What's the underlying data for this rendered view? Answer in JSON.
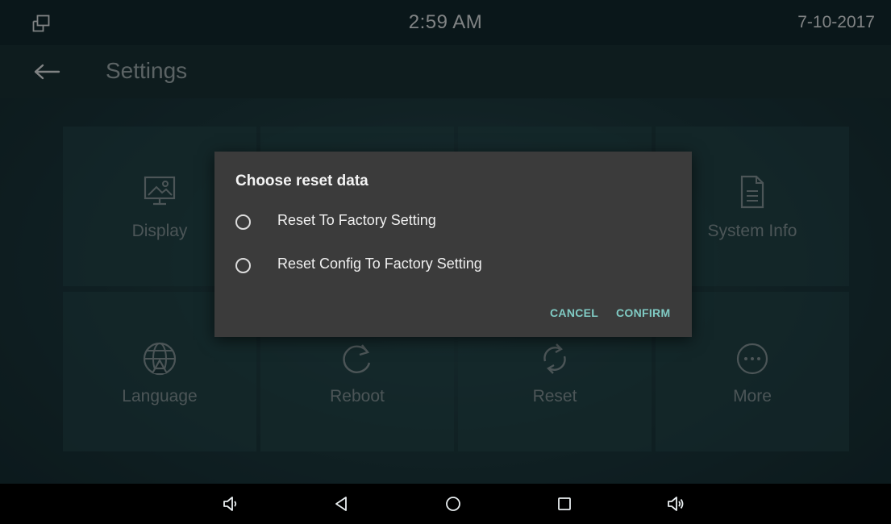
{
  "status_bar": {
    "time": "2:59 AM",
    "date": "7-10-2017",
    "multiwindow_icon": "multi-window-icon"
  },
  "title_bar": {
    "back_icon": "arrow-left-icon",
    "title": "Settings"
  },
  "tiles": [
    {
      "label": "Display",
      "icon": "display-icon"
    },
    {
      "label": "",
      "icon": ""
    },
    {
      "label": "",
      "icon": ""
    },
    {
      "label": "System Info",
      "icon": "document-icon"
    },
    {
      "label": "Language",
      "icon": "globe-icon"
    },
    {
      "label": "Reboot",
      "icon": "reboot-icon"
    },
    {
      "label": "Reset",
      "icon": "sync-icon"
    },
    {
      "label": "More",
      "icon": "more-icon"
    }
  ],
  "dialog": {
    "title": "Choose reset data",
    "options": [
      {
        "label": "Reset To Factory Setting",
        "selected": false
      },
      {
        "label": "Reset Config To Factory Setting",
        "selected": false
      }
    ],
    "cancel_label": "CANCEL",
    "confirm_label": "CONFIRM"
  },
  "nav_bar": {
    "buttons": [
      "volume-down-icon",
      "back-icon",
      "home-icon",
      "recents-icon",
      "volume-up-icon"
    ]
  },
  "colors": {
    "accent": "#80cbc4",
    "dialog_bg": "#3b3b3b"
  }
}
